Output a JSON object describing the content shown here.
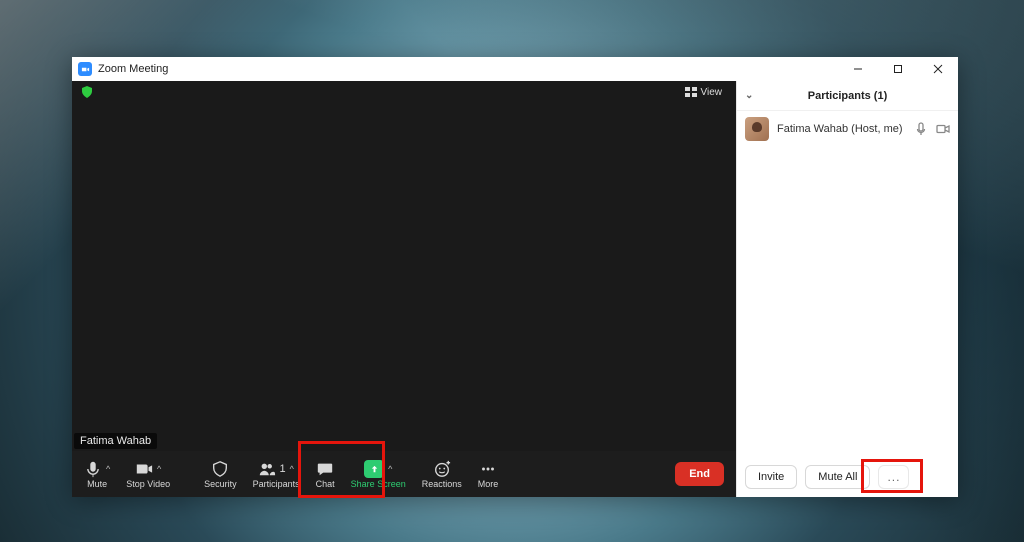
{
  "window": {
    "title": "Zoom Meeting"
  },
  "video": {
    "view_label": "View",
    "self_name": "Fatima Wahab"
  },
  "toolbar": {
    "mute": "Mute",
    "stop_video": "Stop Video",
    "security": "Security",
    "participants": "Participants",
    "participants_count": "1",
    "chat": "Chat",
    "share_screen": "Share Screen",
    "reactions": "Reactions",
    "more": "More",
    "end": "End"
  },
  "panel": {
    "title": "Participants (1)",
    "participants": [
      {
        "name": "Fatima Wahab (Host, me)"
      }
    ],
    "invite": "Invite",
    "mute_all": "Mute All",
    "more": "..."
  }
}
